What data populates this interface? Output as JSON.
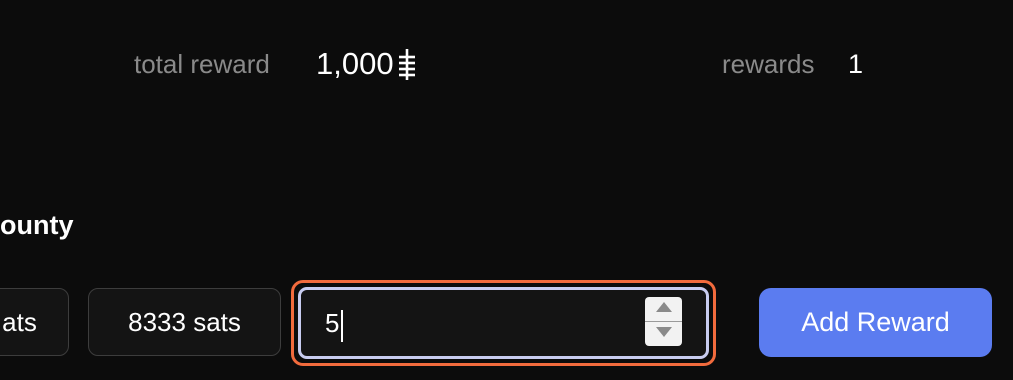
{
  "stats": {
    "total_reward_label": "total reward",
    "total_reward_value": "1,000",
    "total_reward_unit_icon": "sats-symbol-icon",
    "rewards_label": "rewards",
    "rewards_value": "1"
  },
  "section": {
    "title": "ounty"
  },
  "reward_options": [
    {
      "label": "ats"
    },
    {
      "label": "8333 sats"
    }
  ],
  "amount_input": {
    "value": "5",
    "stepper_up_icon": "triangle-up-icon",
    "stepper_down_icon": "triangle-down-icon"
  },
  "add_button": {
    "label": "Add Reward"
  },
  "colors": {
    "background": "#0c0c0c",
    "focus_ring": "#f26b3d",
    "accent": "#5b7cf0"
  }
}
